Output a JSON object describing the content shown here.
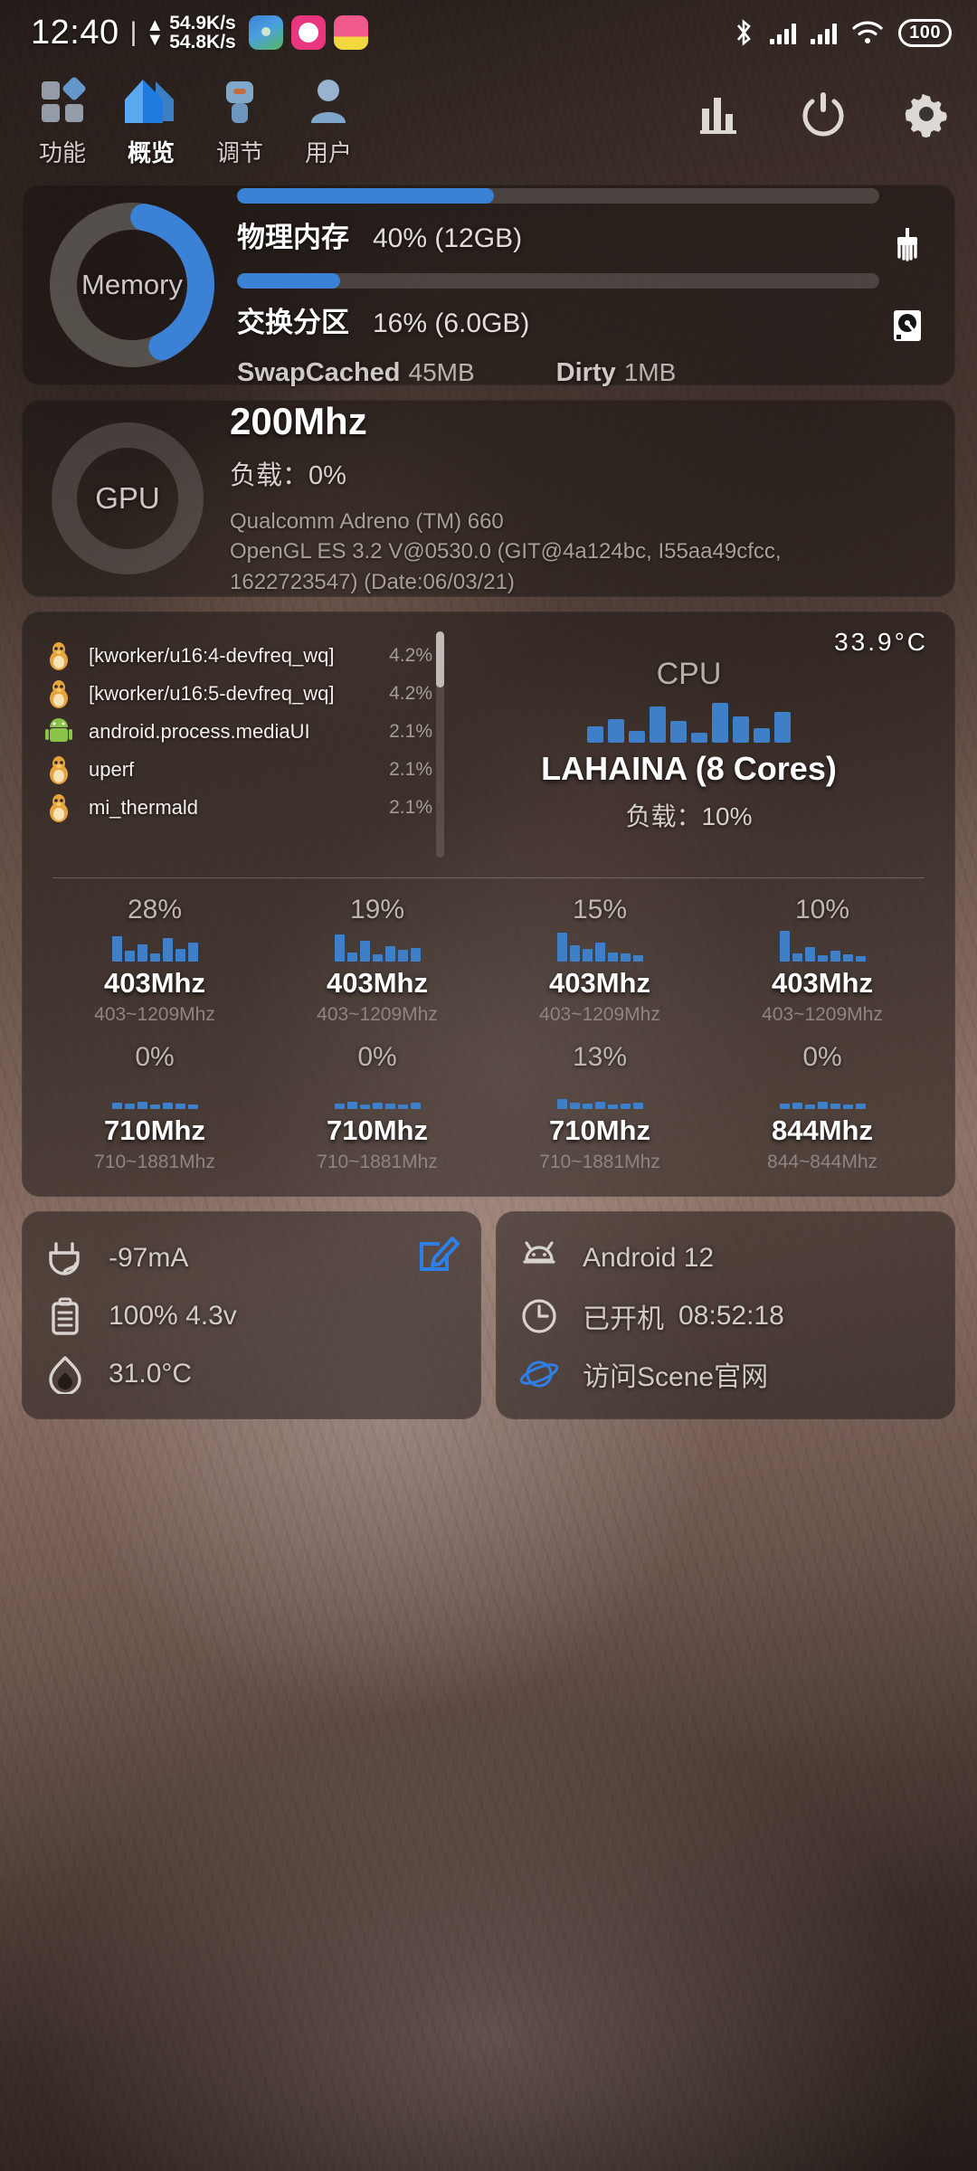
{
  "statusbar": {
    "clock": "12:40",
    "separator": "|",
    "up_speed": "54.9K/s",
    "down_speed": "54.8K/s",
    "up_arrow": "▲",
    "down_arrow": "▼",
    "app_icons": [
      "map-app-icon",
      "music-app-icon",
      "grapefruit-app-icon"
    ],
    "bluetooth_icon": "bluetooth-icon",
    "signal_icon_1": "signal-bars-icon",
    "signal_icon_2": "signal-bars-icon",
    "wifi_icon": "wifi-icon",
    "battery_level": "100"
  },
  "topnav": {
    "tabs": [
      {
        "label": "功能",
        "icon": "grid-squares-icon",
        "active": false
      },
      {
        "label": "概览",
        "icon": "home-icon",
        "active": true
      },
      {
        "label": "调节",
        "icon": "tune-icon",
        "active": false
      },
      {
        "label": "用户",
        "icon": "user-icon",
        "active": false
      }
    ],
    "tools": [
      {
        "icon": "bar-chart-icon",
        "name": "statistics-button"
      },
      {
        "icon": "power-icon",
        "name": "power-button"
      },
      {
        "icon": "gear-icon",
        "name": "settings-button"
      }
    ]
  },
  "memory": {
    "ring_label": "Memory",
    "ring_percent": 40,
    "physical": {
      "label": "物理内存",
      "value": "40% (12GB)",
      "percent": 40
    },
    "swap": {
      "label": "交换分区",
      "value": "16% (6.0GB)",
      "percent": 16
    },
    "swapcached": {
      "label": "SwapCached",
      "value": "45MB"
    },
    "dirty": {
      "label": "Dirty",
      "value": "1MB"
    },
    "clean_icon": "brush-icon",
    "storage_icon": "harddisk-icon"
  },
  "gpu": {
    "ring_label": "GPU",
    "ring_percent": 0,
    "frequency": "200Mhz",
    "load": "负载：0%",
    "description_line1": "Qualcomm Adreno (TM) 660",
    "description_line2": "OpenGL ES 3.2 V@0530.0 (GIT@4a124bc, I55aa49cfcc,",
    "description_line3": "1622723547) (Date:06/03/21)"
  },
  "cpu": {
    "watermark": "CPU",
    "temperature": "33.9°C",
    "name": "LAHAINA (8 Cores)",
    "load": "负载：10%",
    "history": [
      14,
      20,
      10,
      30,
      18,
      8,
      34,
      22,
      12,
      26
    ],
    "processes": [
      {
        "icon": "linux-penguin-icon",
        "name": "[kworker/u16:4-devfreq_wq]",
        "percent": "4.2%"
      },
      {
        "icon": "linux-penguin-icon",
        "name": "[kworker/u16:5-devfreq_wq]",
        "percent": "4.2%"
      },
      {
        "icon": "android-robot-icon",
        "name": "android.process.mediaUI",
        "percent": "2.1%"
      },
      {
        "icon": "linux-penguin-icon",
        "name": "uperf",
        "percent": "2.1%"
      },
      {
        "icon": "linux-penguin-icon",
        "name": "mi_thermald",
        "percent": "2.1%"
      }
    ],
    "cores": [
      {
        "percent": "28%",
        "freq": "403Mhz",
        "range": "403~1209Mhz",
        "history": [
          24,
          10,
          16,
          8,
          22,
          12,
          18
        ]
      },
      {
        "percent": "19%",
        "freq": "403Mhz",
        "range": "403~1209Mhz",
        "history": [
          26,
          9,
          20,
          7,
          15,
          11,
          13
        ]
      },
      {
        "percent": "15%",
        "freq": "403Mhz",
        "range": "403~1209Mhz",
        "history": [
          28,
          16,
          12,
          18,
          9,
          8,
          6
        ]
      },
      {
        "percent": "10%",
        "freq": "403Mhz",
        "range": "403~1209Mhz",
        "history": [
          30,
          8,
          14,
          6,
          10,
          7,
          5
        ]
      },
      {
        "percent": "0%",
        "freq": "710Mhz",
        "range": "710~1881Mhz",
        "history": [
          6,
          5,
          7,
          4,
          6,
          5,
          4
        ]
      },
      {
        "percent": "0%",
        "freq": "710Mhz",
        "range": "710~1881Mhz",
        "history": [
          5,
          7,
          4,
          6,
          5,
          4,
          6
        ]
      },
      {
        "percent": "13%",
        "freq": "710Mhz",
        "range": "710~1881Mhz",
        "history": [
          9,
          6,
          5,
          7,
          4,
          5,
          6
        ]
      },
      {
        "percent": "0%",
        "freq": "844Mhz",
        "range": "844~844Mhz",
        "history": [
          5,
          6,
          4,
          7,
          5,
          4,
          5
        ]
      }
    ]
  },
  "battery_card": {
    "current": "-97mA",
    "level_voltage": "100%  4.3v",
    "temperature": "31.0°C",
    "plug_icon": "power-plug-icon",
    "battery_icon": "battery-clipboard-icon",
    "flame_icon": "flame-icon",
    "edit_icon": "edit-pencil-icon"
  },
  "system_card": {
    "os_version": "Android 12",
    "uptime_label": "已开机",
    "uptime_value": "08:52:18",
    "website_link": "访问Scene官网",
    "android_icon": "android-head-icon",
    "clock_icon": "clock-icon",
    "planet_icon": "planet-browser-icon"
  },
  "colors": {
    "accent_blue": "#3b82d6",
    "card_bg": "rgba(22,17,15,.50)",
    "text_primary": "#ffffff",
    "text_secondary": "#b9b2ae"
  }
}
